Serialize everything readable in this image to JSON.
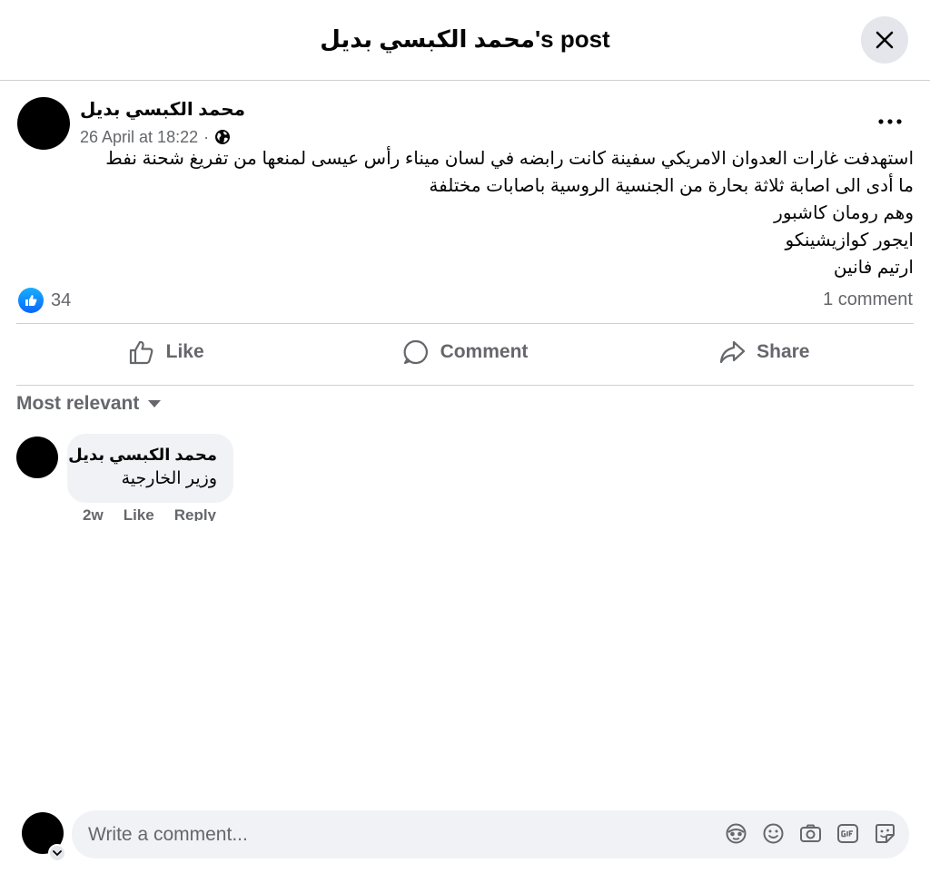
{
  "header": {
    "title": "محمد الكبسي بديل's post"
  },
  "post": {
    "author": "محمد الكبسي بديل",
    "timestamp": "26 April at 18:22",
    "separator": "·",
    "privacy_icon": "globe-icon",
    "text_lines": [
      "استهدفت غارات العدوان الامريكي سفينة كانت رابضه في لسان ميناء رأس عيسى لمنعها من تفريغ شحنة نفط",
      "ما أدى الى اصابة ثلاثة بحارة من الجنسية الروسية باصابات مختلفة",
      "وهم رومان كاشبور",
      "ايجور كوازيشينكو",
      "ارتيم فانين"
    ],
    "reaction_count": "34",
    "comment_count": "1 comment"
  },
  "actions": {
    "like": "Like",
    "comment": "Comment",
    "share": "Share"
  },
  "comments": {
    "sort_label": "Most relevant",
    "items": [
      {
        "author": "محمد الكبسي بديل",
        "text": "وزير الخارجية",
        "time": "2w",
        "like": "Like",
        "reply": "Reply"
      }
    ]
  },
  "composer": {
    "placeholder": "Write a comment...",
    "icons": [
      "avatar-sticker-icon",
      "emoji-icon",
      "camera-icon",
      "gif-icon",
      "sticker-icon"
    ]
  },
  "colors": {
    "accent": "#0866ff",
    "secondary_text": "#65676b",
    "divider": "#ced0d4",
    "surface": "#f0f2f5"
  }
}
